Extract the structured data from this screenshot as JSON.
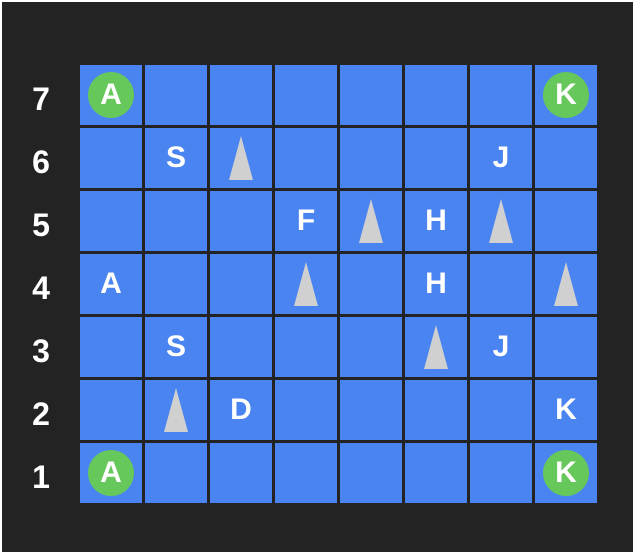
{
  "board": {
    "rows": 7,
    "cols": 8,
    "row_labels": [
      "7",
      "6",
      "5",
      "4",
      "3",
      "2",
      "1"
    ],
    "colors": {
      "background": "#232323",
      "cell": "#4a84f0",
      "badge": "#66c85a",
      "cone": "#d0d0d0",
      "text": "#ffffff"
    },
    "pieces": [
      {
        "row": 0,
        "col": 0,
        "type": "badge",
        "text": "A"
      },
      {
        "row": 0,
        "col": 7,
        "type": "badge",
        "text": "K"
      },
      {
        "row": 1,
        "col": 1,
        "type": "letter",
        "text": "S"
      },
      {
        "row": 1,
        "col": 2,
        "type": "cone",
        "text": ""
      },
      {
        "row": 1,
        "col": 6,
        "type": "letter",
        "text": "J"
      },
      {
        "row": 2,
        "col": 3,
        "type": "letter",
        "text": "F"
      },
      {
        "row": 2,
        "col": 4,
        "type": "cone",
        "text": ""
      },
      {
        "row": 2,
        "col": 5,
        "type": "letter",
        "text": "H"
      },
      {
        "row": 2,
        "col": 6,
        "type": "cone",
        "text": ""
      },
      {
        "row": 3,
        "col": 0,
        "type": "letter",
        "text": "A"
      },
      {
        "row": 3,
        "col": 3,
        "type": "cone",
        "text": ""
      },
      {
        "row": 3,
        "col": 5,
        "type": "letter",
        "text": "H"
      },
      {
        "row": 3,
        "col": 7,
        "type": "cone",
        "text": ""
      },
      {
        "row": 4,
        "col": 1,
        "type": "letter",
        "text": "S"
      },
      {
        "row": 4,
        "col": 5,
        "type": "cone",
        "text": ""
      },
      {
        "row": 4,
        "col": 6,
        "type": "letter",
        "text": "J"
      },
      {
        "row": 5,
        "col": 1,
        "type": "cone",
        "text": ""
      },
      {
        "row": 5,
        "col": 2,
        "type": "letter",
        "text": "D"
      },
      {
        "row": 5,
        "col": 7,
        "type": "letter",
        "text": "K"
      },
      {
        "row": 6,
        "col": 0,
        "type": "badge",
        "text": "A"
      },
      {
        "row": 6,
        "col": 7,
        "type": "badge",
        "text": "K"
      }
    ]
  }
}
